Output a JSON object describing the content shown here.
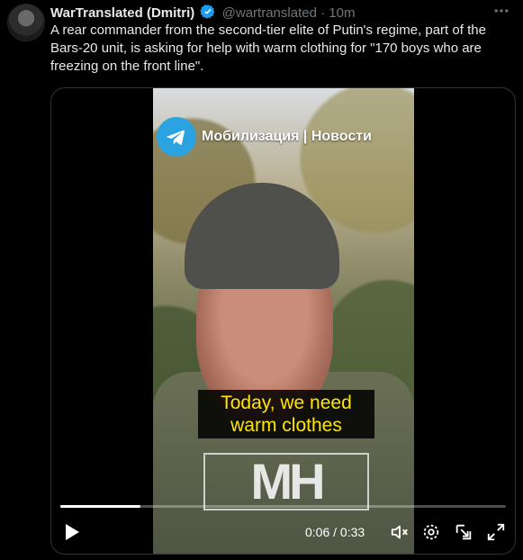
{
  "tweet": {
    "author_name": "WarTranslated (Dmitri)",
    "handle": "@wartranslated",
    "separator": "·",
    "time": "10m",
    "text": "A rear commander from the second-tier elite of Putin's regime, part of the Bars-20 unit, is asking for help with warm clothing for \"170 boys who are freezing on the front line\"."
  },
  "video": {
    "channel_title": "Мобилизация | Новости",
    "caption": "Today, we need warm clothes",
    "watermark": "МН",
    "current_time": "0:06",
    "duration": "0:33",
    "time_display": "0:06 / 0:33",
    "progress_fraction": 0.18
  },
  "icons": [
    "verified-icon",
    "more-icon",
    "telegram-icon",
    "play-icon",
    "mute-icon",
    "settings-icon",
    "pip-icon",
    "fullscreen-icon"
  ],
  "colors": {
    "background": "#000000",
    "text": "#e7e9ea",
    "muted": "#71767b",
    "verified": "#1d9bf0",
    "caption": "#ffe600",
    "telegram": "#2aa3e0"
  }
}
